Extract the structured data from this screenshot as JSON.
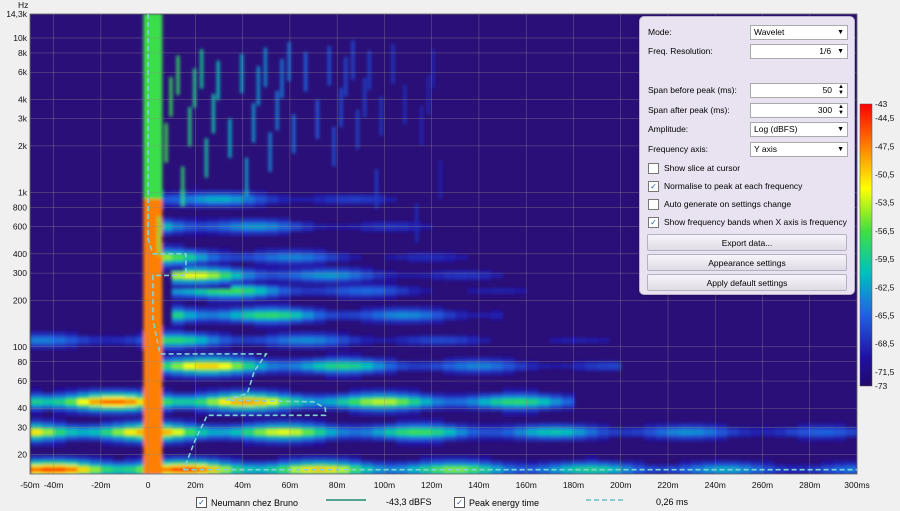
{
  "chart_data": {
    "type": "heatmap",
    "x_unit_label": "ms",
    "y_unit_label": "Hz",
    "x_range_ms": [
      -50,
      300
    ],
    "y_range_hz": [
      15,
      14300
    ],
    "x_ticks": [
      "-50m",
      "-40m",
      "-20m",
      "0",
      "20m",
      "40m",
      "60m",
      "80m",
      "100m",
      "120m",
      "140m",
      "160m",
      "180m",
      "200m",
      "220m",
      "240m",
      "260m",
      "280m",
      "300ms"
    ],
    "x_tick_values": [
      -50,
      -40,
      -20,
      0,
      20,
      40,
      60,
      80,
      100,
      120,
      140,
      160,
      180,
      200,
      220,
      240,
      260,
      280,
      300
    ],
    "y_ticks": [
      "14,3k",
      "10k",
      "8k",
      "6k",
      "4k",
      "3k",
      "2k",
      "1k",
      "800",
      "600",
      "400",
      "300",
      "200",
      "100",
      "80",
      "60",
      "40",
      "30",
      "20"
    ],
    "y_tick_values": [
      14300,
      10000,
      8000,
      6000,
      4000,
      3000,
      2000,
      1000,
      800,
      600,
      400,
      300,
      200,
      100,
      80,
      60,
      40,
      30,
      20
    ],
    "colorbar_labels": [
      "-43",
      "-44,5",
      "-47,5",
      "-50,5",
      "-53,5",
      "-56,5",
      "-59,5",
      "-62,5",
      "-65,5",
      "-68,5",
      "-71,5",
      "-73"
    ],
    "colorbar_values": [
      -43,
      -44.5,
      -47.5,
      -50.5,
      -53.5,
      -56.5,
      -59.5,
      -62.5,
      -65.5,
      -68.5,
      -71.5,
      -73
    ],
    "grid": true,
    "peak_energy_time": {
      "points_ms_hz": [
        [
          0,
          14300
        ],
        [
          0,
          2000
        ],
        [
          0,
          800
        ],
        [
          0,
          500
        ],
        [
          2,
          400
        ],
        [
          16,
          400
        ],
        [
          16,
          290
        ],
        [
          2,
          290
        ],
        [
          2,
          150
        ],
        [
          5,
          90
        ],
        [
          50,
          90
        ],
        [
          45,
          70
        ],
        [
          42,
          50
        ],
        [
          33,
          45
        ],
        [
          70,
          44
        ],
        [
          75,
          40
        ],
        [
          75,
          36
        ],
        [
          25,
          36
        ],
        [
          20,
          25
        ],
        [
          15,
          16
        ]
      ]
    },
    "ridges_hz": [
      {
        "hz": 16,
        "from_ms": -50,
        "to_ms": 300,
        "level": 1.0
      },
      {
        "hz": 28,
        "from_ms": -50,
        "to_ms": 300,
        "level": 0.85
      },
      {
        "hz": 44,
        "from_ms": -50,
        "to_ms": 180,
        "level": 0.95
      },
      {
        "hz": 75,
        "from_ms": 0,
        "to_ms": 200,
        "level": 0.9
      },
      {
        "hz": 110,
        "from_ms": -50,
        "to_ms": 300,
        "level": 0.55
      },
      {
        "hz": 160,
        "from_ms": 10,
        "to_ms": 150,
        "level": 0.75
      },
      {
        "hz": 230,
        "from_ms": 10,
        "to_ms": 160,
        "level": 0.8
      },
      {
        "hz": 290,
        "from_ms": 10,
        "to_ms": 190,
        "level": 0.85
      },
      {
        "hz": 380,
        "from_ms": 5,
        "to_ms": 200,
        "level": 0.65
      },
      {
        "hz": 600,
        "from_ms": 5,
        "to_ms": 150,
        "level": 0.6
      },
      {
        "hz": 900,
        "from_ms": 5,
        "to_ms": 120,
        "level": 0.55
      }
    ]
  },
  "panel": {
    "mode_label": "Mode:",
    "mode_value": "Wavelet",
    "freq_res_label": "Freq. Resolution:",
    "freq_res_value": "1/6",
    "span_before_label": "Span before peak (ms):",
    "span_before_value": "50",
    "span_after_label": "Span after peak (ms):",
    "span_after_value": "300",
    "amplitude_label": "Amplitude:",
    "amplitude_value": "Log (dBFS)",
    "freq_axis_label": "Frequency axis:",
    "freq_axis_value": "Y axis",
    "show_slice": "Show slice at cursor",
    "normalise": "Normalise to peak at each frequency",
    "auto_generate": "Auto generate on settings change",
    "show_bands": "Show frequency bands when X axis is frequency",
    "export_btn": "Export data...",
    "appearance_btn": "Appearance settings",
    "defaults_btn": "Apply default settings"
  },
  "legend": {
    "measurement": "Neumann chez Bruno",
    "measurement_value": "-43,3 dBFS",
    "peak": "Peak energy time",
    "peak_value": "0,26 ms"
  },
  "colors": {
    "line": "#1e8a6e",
    "dash": "#7fd3d8",
    "bg_plot": "#2a0f78"
  }
}
